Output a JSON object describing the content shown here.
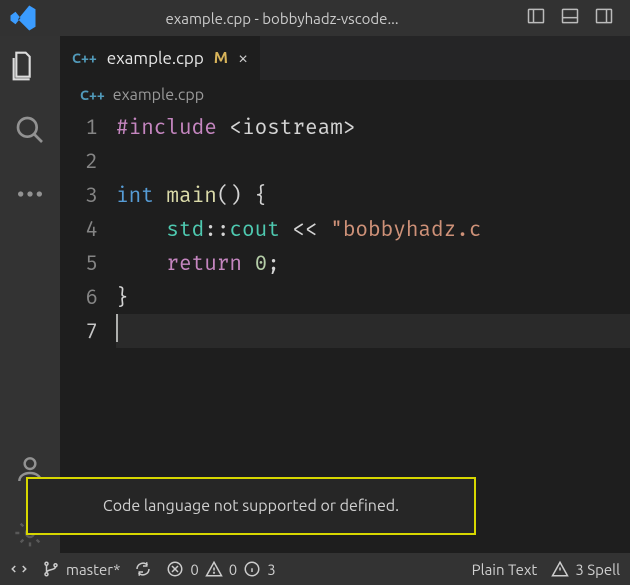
{
  "titlebar": {
    "title": "example.cpp - bobbyhadz-vscode..."
  },
  "tab": {
    "lang_prefix": "C++",
    "filename": "example.cpp",
    "modified_badge": "M"
  },
  "breadcrumb": {
    "lang_prefix": "C++",
    "filename": "example.cpp"
  },
  "code": {
    "line_numbers": [
      "1",
      "2",
      "3",
      "4",
      "5",
      "6",
      "7"
    ],
    "lines": [
      {
        "tokens": [
          [
            "kw",
            "#include"
          ],
          [
            "pun",
            " <iostream>"
          ]
        ]
      },
      {
        "tokens": []
      },
      {
        "tokens": [
          [
            "ty",
            "int"
          ],
          [
            "pun",
            " "
          ],
          [
            "fn",
            "main"
          ],
          [
            "pun",
            "() {"
          ]
        ]
      },
      {
        "tokens": [
          [
            "pun",
            "    "
          ],
          [
            "ns",
            "std"
          ],
          [
            "pun",
            "::"
          ],
          [
            "ns",
            "cout"
          ],
          [
            "pun",
            " << "
          ],
          [
            "str",
            "\"bobbyhadz.c"
          ]
        ]
      },
      {
        "tokens": [
          [
            "pun",
            "    "
          ],
          [
            "kw",
            "return"
          ],
          [
            "pun",
            " "
          ],
          [
            "num",
            "0"
          ],
          [
            "pun",
            ";"
          ]
        ]
      },
      {
        "tokens": [
          [
            "pun",
            "}"
          ]
        ]
      },
      {
        "tokens": []
      }
    ],
    "cursor_line": 7
  },
  "notification": {
    "message": "Code language not supported or defined."
  },
  "statusbar": {
    "branch": "master*",
    "errors": "0",
    "warnings": "0",
    "info": "3",
    "language": "Plain Text",
    "spell_count": "3 Spell"
  }
}
